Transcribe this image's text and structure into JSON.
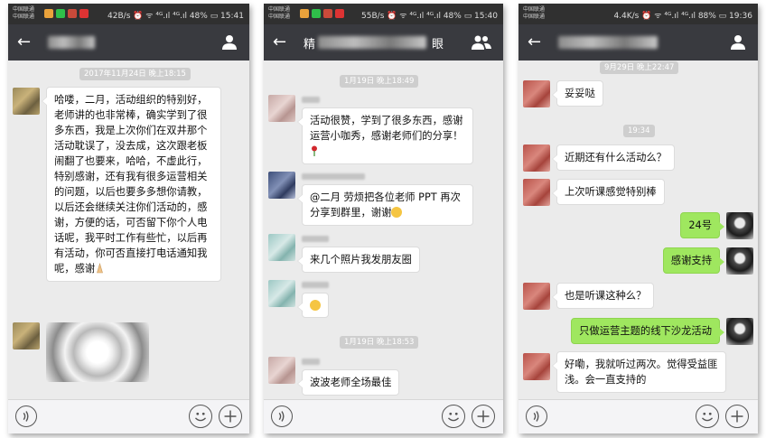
{
  "colors": {
    "navbar": "#393a3f",
    "statusbar": "#303030",
    "chat_bg": "#ebebeb",
    "bubble_in": "#ffffff",
    "bubble_out": "#9fe75f"
  },
  "screens": [
    {
      "status": {
        "carrier1": "中国联通",
        "carrier2": "中国联通",
        "right": "42B/s ⏰ ᯤ ⁴ᴳ.ıl ⁴ᴳ.ıl 48% ▭ 15:41"
      },
      "nav": {
        "nav_icon": "person-icon"
      },
      "timestamp": "2017年11月24日 晚上18:15",
      "messages": [
        {
          "text": "哈喽，二月，活动组织的特别好，老师讲的也非常棒，确实学到了很多东西，我是上次你们在双井那个活动耽误了，没去成，这次跟老板闹翻了也要来，哈哈，不虚此行，特别感谢，还有我有很多运营相关的问题，以后也要多多想你请教，以后还会继续关注你们活动的，感谢，方便的话，可否留下你个人电话呢，我平时工作有些忙，以后再有活动，你可否直接打电话通知我呢，感谢",
          "trailing_emoji": "pray-emoji"
        }
      ]
    },
    {
      "status": {
        "carrier1": "中国联通",
        "carrier2": "中国联通",
        "right": "55B/s ⏰ ᯤ ⁴ᴳ.ıl ⁴ᴳ.ıl 48% ▭ 15:40"
      },
      "nav": {
        "title": "精",
        "title_tail": "眼",
        "nav_icon": "group-icon"
      },
      "timestamps": [
        "1月19日 晚上18:49",
        "1月19日 晚上18:53"
      ],
      "messages": [
        {
          "text": "活动很赞，学到了很多东西，感谢运营小咖秀，感谢老师们的分享！",
          "trailing_emoji": "rose-emoji"
        },
        {
          "text": "@二月   劳烦把各位老师 PPT 再次分享到群里，谢谢",
          "trailing_emoji": "sun-emoji"
        },
        {
          "text": "来几个照片我发朋友圈"
        },
        {
          "text": "",
          "trailing_emoji": "grin-emoji"
        },
        {
          "text": "波波老师全场最佳"
        }
      ]
    },
    {
      "status": {
        "carrier1": "中国联通",
        "carrier2": "中国联通",
        "right": "4.4K/s ⏰ ᯤ ⁴ᴳ.ıl ⁴ᴳ.ıl 88% ▭ 19:36"
      },
      "nav": {
        "nav_icon": "person-icon"
      },
      "timestamps": [
        "9月29日 晚上22:47",
        "19:34"
      ],
      "messages": [
        {
          "side": "left",
          "text": "妥妥哒"
        },
        {
          "side": "left",
          "text": "近期还有什么活动么？"
        },
        {
          "side": "left",
          "text": "上次听课感觉特别棒"
        },
        {
          "side": "right",
          "text": "24号"
        },
        {
          "side": "right",
          "text": "感谢支持"
        },
        {
          "side": "left",
          "text": "也是听课这种么？"
        },
        {
          "side": "right",
          "text": "只做运营主题的线下沙龙活动"
        },
        {
          "side": "left",
          "text": "好嘞，我就听过两次。觉得受益匪浅。会一直支持的"
        }
      ]
    }
  ]
}
